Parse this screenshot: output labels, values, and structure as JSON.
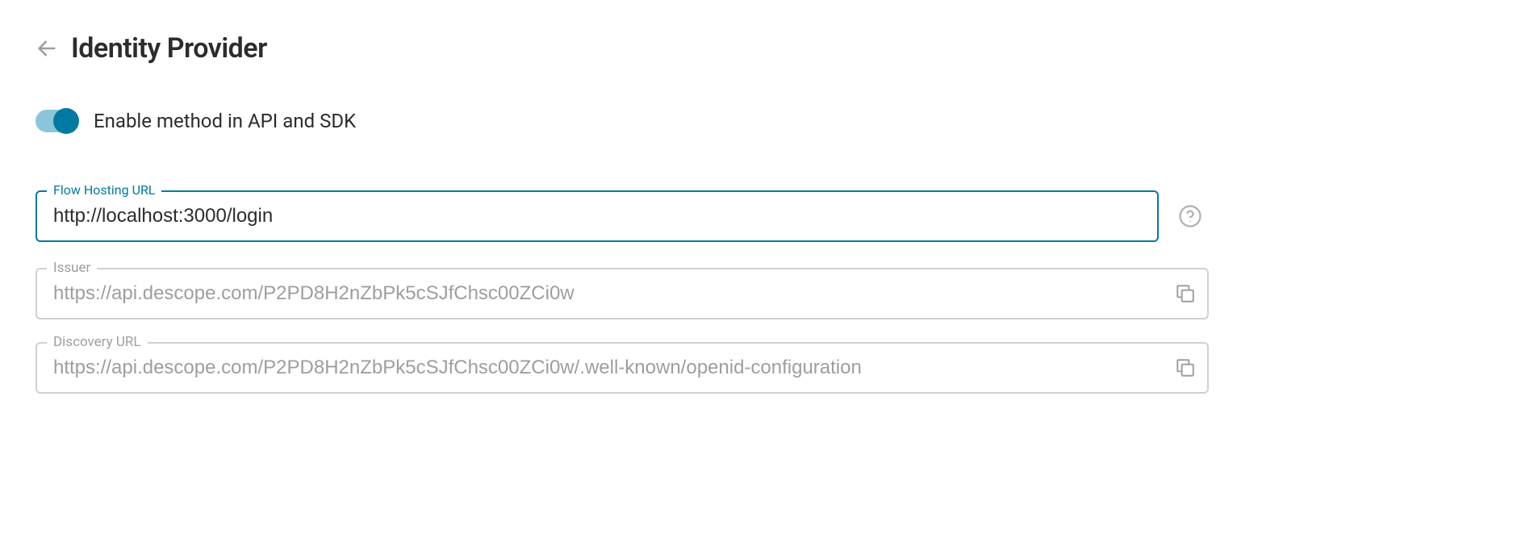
{
  "header": {
    "title": "Identity Provider"
  },
  "toggle": {
    "label": "Enable method in API and SDK",
    "enabled": true
  },
  "fields": {
    "flowHostingUrl": {
      "label": "Flow Hosting URL",
      "value": "http://localhost:3000/login"
    },
    "issuer": {
      "label": "Issuer",
      "value": "https://api.descope.com/P2PD8H2nZbPk5cSJfChsc00ZCi0w"
    },
    "discoveryUrl": {
      "label": "Discovery URL",
      "value": "https://api.descope.com/P2PD8H2nZbPk5cSJfChsc00ZCi0w/.well-known/openid-configuration"
    }
  }
}
